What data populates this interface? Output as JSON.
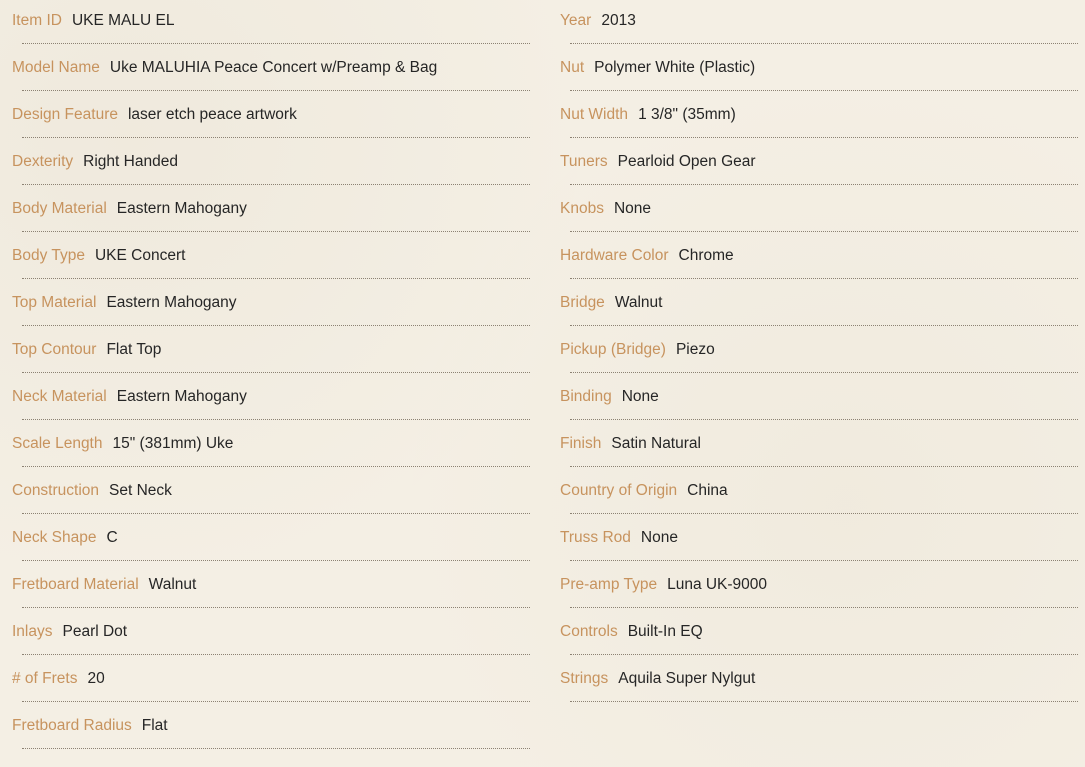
{
  "specs": {
    "left": [
      {
        "label": "Item ID",
        "value": "UKE MALU EL"
      },
      {
        "label": "Model Name",
        "value": "Uke MALUHIA Peace Concert w/Preamp & Bag"
      },
      {
        "label": "Design Feature",
        "value": "laser etch peace artwork"
      },
      {
        "label": "Dexterity",
        "value": "Right Handed"
      },
      {
        "label": "Body Material",
        "value": "Eastern Mahogany"
      },
      {
        "label": "Body Type",
        "value": "UKE Concert"
      },
      {
        "label": "Top Material",
        "value": "Eastern Mahogany"
      },
      {
        "label": "Top Contour",
        "value": "Flat Top"
      },
      {
        "label": "Neck Material",
        "value": "Eastern Mahogany"
      },
      {
        "label": "Scale Length",
        "value": "15\" (381mm) Uke"
      },
      {
        "label": "Construction",
        "value": "Set Neck"
      },
      {
        "label": "Neck Shape",
        "value": "C"
      },
      {
        "label": "Fretboard Material",
        "value": "Walnut"
      },
      {
        "label": "Inlays",
        "value": "Pearl Dot"
      },
      {
        "label": "# of Frets",
        "value": "20"
      },
      {
        "label": "Fretboard Radius",
        "value": "Flat"
      }
    ],
    "right": [
      {
        "label": "Year",
        "value": "2013"
      },
      {
        "label": "Nut",
        "value": "Polymer White (Plastic)"
      },
      {
        "label": "Nut Width",
        "value": "1 3/8\" (35mm)"
      },
      {
        "label": "Tuners",
        "value": "Pearloid Open Gear"
      },
      {
        "label": "Knobs",
        "value": "None"
      },
      {
        "label": "Hardware Color",
        "value": "Chrome"
      },
      {
        "label": "Bridge",
        "value": "Walnut"
      },
      {
        "label": "Pickup (Bridge)",
        "value": "Piezo"
      },
      {
        "label": "Binding",
        "value": "None"
      },
      {
        "label": "Finish",
        "value": "Satin Natural"
      },
      {
        "label": "Country of Origin",
        "value": "China"
      },
      {
        "label": "Truss Rod",
        "value": "None"
      },
      {
        "label": "Pre-amp Type",
        "value": "Luna UK-9000"
      },
      {
        "label": "Controls",
        "value": "Built-In EQ"
      },
      {
        "label": "Strings",
        "value": "Aquila Super Nylgut"
      }
    ]
  },
  "colors": {
    "background": "#f4efe4",
    "label": "#c7935e",
    "value": "#262626",
    "rule": "#8c8273"
  }
}
